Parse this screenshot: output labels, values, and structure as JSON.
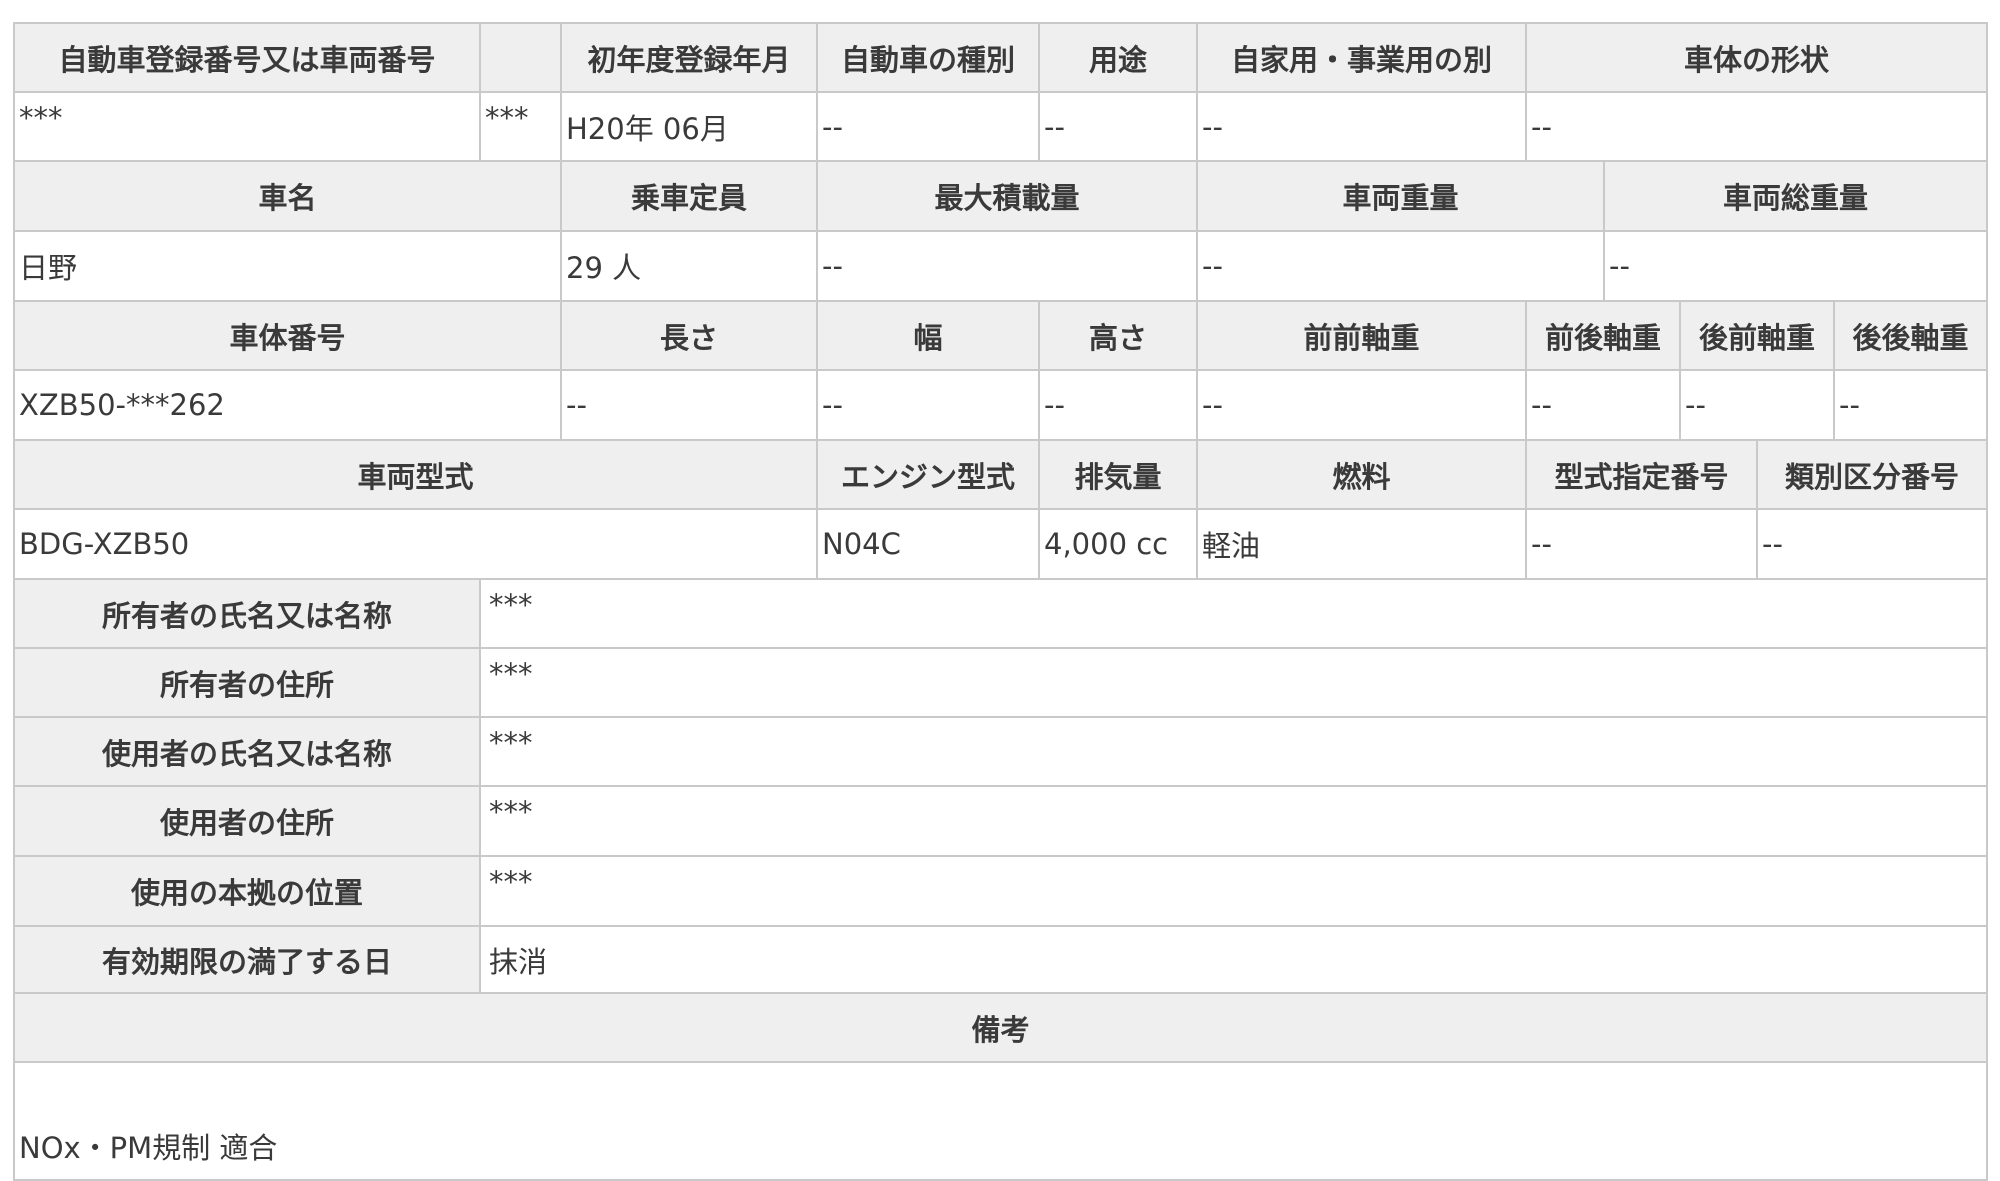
{
  "row1": {
    "headers": {
      "reg_no": "自動車登録番号又は車両番号",
      "reg_sub": "",
      "first_reg": "初年度登録年月",
      "vehicle_kind": "自動車の種別",
      "usage": "用途",
      "private_business": "自家用・事業用の別",
      "body_shape": "車体の形状"
    },
    "values": {
      "reg_no": "***",
      "reg_sub": "***",
      "first_reg": "H20年 06月",
      "vehicle_kind": "--",
      "usage": "--",
      "private_business": "--",
      "body_shape": "--"
    }
  },
  "row2": {
    "headers": {
      "car_name": "車名",
      "capacity": "乗車定員",
      "max_load": "最大積載量",
      "vehicle_weight": "車両重量",
      "gross_weight": "車両総重量"
    },
    "values": {
      "car_name": "日野",
      "capacity": "29 人",
      "max_load": "--",
      "vehicle_weight": "--",
      "gross_weight": "--"
    }
  },
  "row3": {
    "headers": {
      "chassis_no": "車体番号",
      "length": "長さ",
      "width": "幅",
      "height": "高さ",
      "ff_axle": "前前軸重",
      "fr_axle": "前後軸重",
      "rf_axle": "後前軸重",
      "rr_axle": "後後軸重"
    },
    "values": {
      "chassis_no": "XZB50-***262",
      "length": "--",
      "width": "--",
      "height": "--",
      "ff_axle": "--",
      "fr_axle": "--",
      "rf_axle": "--",
      "rr_axle": "--"
    }
  },
  "row4": {
    "headers": {
      "model": "車両型式",
      "engine_model": "エンジン型式",
      "displacement": "排気量",
      "fuel": "燃料",
      "type_designation": "型式指定番号",
      "category_no": "類別区分番号"
    },
    "values": {
      "model": "BDG-XZB50",
      "engine_model": "N04C",
      "displacement": "4,000 cc",
      "fuel": "軽油",
      "type_designation": "--",
      "category_no": "--"
    }
  },
  "info_rows": [
    {
      "label": "所有者の氏名又は名称",
      "value": "***"
    },
    {
      "label": "所有者の住所",
      "value": "***"
    },
    {
      "label": "使用者の氏名又は名称",
      "value": "***"
    },
    {
      "label": "使用者の住所",
      "value": "***"
    },
    {
      "label": "使用の本拠の位置",
      "value": "***"
    },
    {
      "label": "有効期限の満了する日",
      "value": "抹消"
    }
  ],
  "remarks": {
    "label": "備考",
    "value": "NOx・PM規制 適合"
  }
}
